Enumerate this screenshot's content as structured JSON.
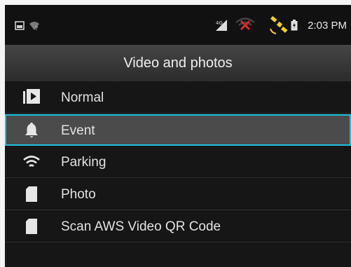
{
  "status_bar": {
    "time": "2:03 PM",
    "icons": [
      "screenshot-icon",
      "wifi-no-internet-icon",
      "signal-4g-icon",
      "no-gps-icon",
      "satellite-icon",
      "battery-icon"
    ],
    "colors": {
      "no_signal": "#d42a2a",
      "satellite": "#f2d21a"
    }
  },
  "header": {
    "title": "Video and photos"
  },
  "menu": {
    "items": [
      {
        "label": "Normal",
        "icon": "play-video-icon"
      },
      {
        "label": "Event",
        "icon": "bell-icon",
        "selected": true
      },
      {
        "label": "Parking",
        "icon": "wifi-icon"
      },
      {
        "label": "Photo",
        "icon": "sd-card-icon"
      },
      {
        "label": "Scan AWS Video QR Code",
        "icon": "sd-card-icon"
      }
    ],
    "selected_border_color": "#1dc2e2"
  }
}
